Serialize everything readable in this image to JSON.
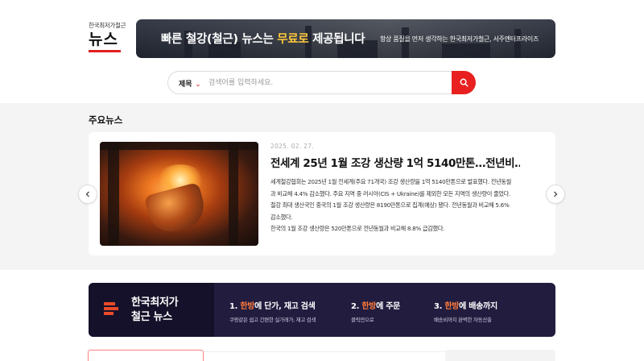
{
  "header": {
    "logo_sub": "한국최저가철근",
    "logo_main": "뉴스",
    "brand_color": "#e02020"
  },
  "banner": {
    "part1": "빠른 철강(철근) 뉴스는 ",
    "highlight": "무료로",
    "part2": " 제공됩니다",
    "sub": "항상 품질을 먼저 생각하는 한국최저가철근, 서주엔터프라이즈",
    "highlight_color": "#ffc93c"
  },
  "search": {
    "select_label": "제목",
    "placeholder": "검색어를 입력하세요.",
    "button_icon": "search-icon"
  },
  "main_news": {
    "section_title": "주요뉴스",
    "date": "2025. 02. 27.",
    "headline": "전세계 25년 1월 조강 생산량 1억 5140만톤…전년비…",
    "paragraphs": [
      "세계철강협회는 2025년 1월 전세계(주요 71개국) 조강 생산량을 1억 5140만톤으로 발표했다. 전년동월과 비교해 4.4% 감소했다. 주요 지역 중 러시아(CIS + Ukraine)를 제외한 모든 지역의 생산량이 줄었다.",
      "철강 최대 생산국인 중국의 1월 조강 생산량은 8190만톤으로 집계(예상) 됐다. 전년동월과 비교해 5.6% 감소했다.",
      "한국의 1월 조강 생산량은 520만톤으로 전년동월과 비교해 8.8% 급감했다."
    ],
    "prev_icon": "chevron-left-icon",
    "next_icon": "chevron-right-icon"
  },
  "promo": {
    "title_line1": "한국최저가",
    "title_line2": "철근 뉴스",
    "steps": [
      {
        "num": "1. ",
        "hl": "한방",
        "rest": "에 단가, 재고 검색",
        "desc": "쿠팡같은 쉽고 간편한 실가래가, 재고 검색"
      },
      {
        "num": "2. ",
        "hl": "한방",
        "rest": "에 주문",
        "desc": "클릭만으로"
      },
      {
        "num": "3. ",
        "hl": "한방",
        "rest": "에 배송까지",
        "desc": "배송비까지 완벽한 자동산출"
      }
    ],
    "accent_color": "#ff7a3c",
    "bg_color": "#221d3f"
  }
}
